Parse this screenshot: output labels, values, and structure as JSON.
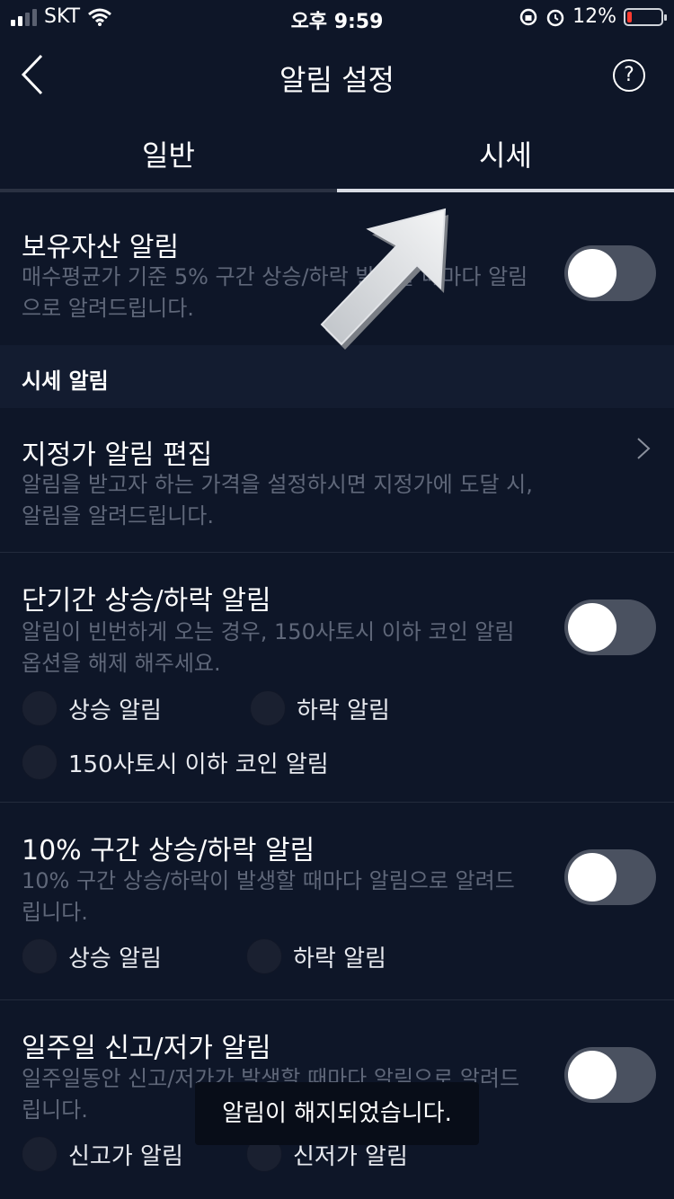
{
  "status_bar": {
    "carrier": "SKT",
    "time": "오후 9:59",
    "battery_percent": "12%",
    "signal_icon": "signal-bars-icon",
    "wifi_icon": "wifi-icon",
    "lock_icon": "rotation-lock-icon",
    "alarm_icon": "alarm-clock-icon",
    "battery_level": 0.12,
    "battery_color": "#ff3b30"
  },
  "header": {
    "title": "알림 설정",
    "back_icon": "chevron-left-icon",
    "help_label": "?"
  },
  "tabs": [
    {
      "label": "일반",
      "active": false
    },
    {
      "label": "시세",
      "active": true
    }
  ],
  "sections": {
    "holdings": {
      "title": "보유자산 알림",
      "desc": "매수평균가 기준 5% 구간 상승/하락 발생할 때마다 알림으로 알려드립니다.",
      "toggle_on": false
    },
    "group_label": "시세 알림",
    "target_price": {
      "title": "지정가 알림 편집",
      "desc": "알림을 받고자 하는 가격을 설정하시면 지정가에 도달 시, 알림을 알려드립니다."
    },
    "short_term": {
      "title": "단기간 상승/하락 알림",
      "desc": "알림이 빈번하게 오는 경우, 150사토시 이하 코인 알림 옵션을 해제 해주세요.",
      "toggle_on": false,
      "options": [
        "상승 알림",
        "하락 알림",
        "150사토시 이하 코인 알림"
      ]
    },
    "ten_percent": {
      "title": "10% 구간 상승/하락 알림",
      "desc": "10% 구간 상승/하락이 발생할 때마다 알림으로 알려드립니다.",
      "toggle_on": false,
      "options": [
        "상승 알림",
        "하락 알림"
      ]
    },
    "weekly": {
      "title": "일주일 신고/저가 알림",
      "desc": "일주일동안 신고/저가가 발생할 때마다 알림으로 알려드립니다.",
      "toggle_on": false,
      "options": [
        "신고가 알림",
        "신저가 알림"
      ]
    }
  },
  "toast": "알림이 해지되었습니다.",
  "colors": {
    "background": "#0e1628",
    "muted_text": "#5f6779",
    "toggle_off": "#4a5160"
  }
}
